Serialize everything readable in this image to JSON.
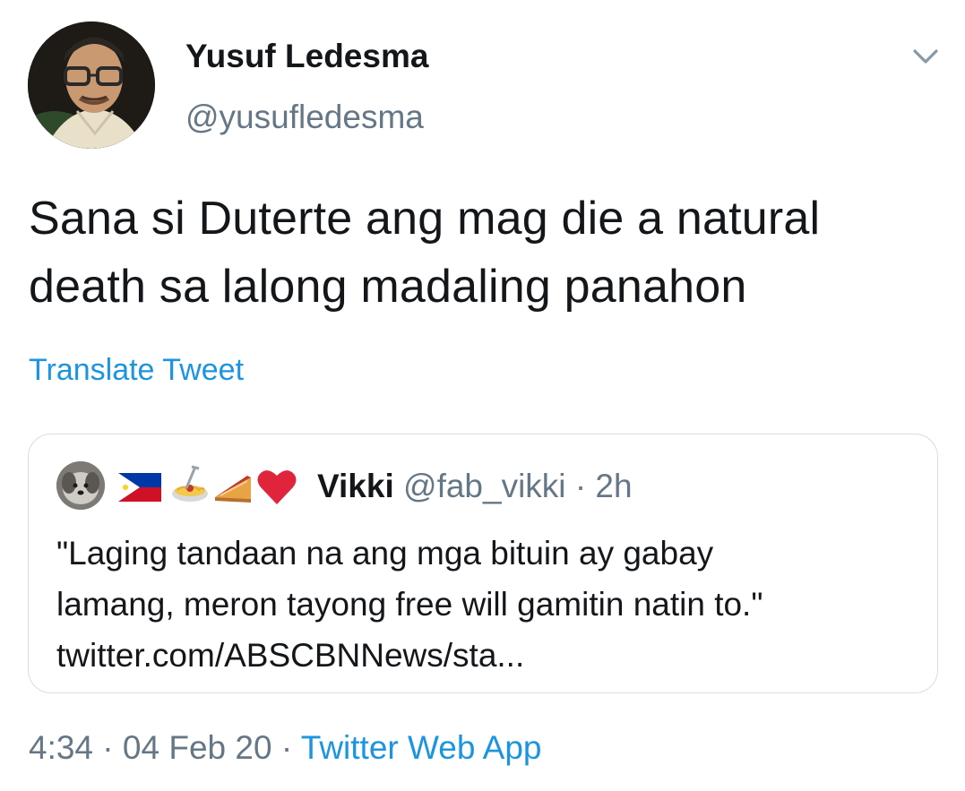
{
  "author": {
    "name": "Yusuf Ledesma",
    "handle": "@yusufledesma",
    "avatar_icon": "profile-photo"
  },
  "tweet": {
    "text": "Sana si Duterte ang mag die a natural\ndeath sa lalong madaling panahon",
    "translate_label": "Translate Tweet"
  },
  "quoted_tweet": {
    "name": "Vikki",
    "handle": "@fab_vikki",
    "separator": "·",
    "time": "2h",
    "name_emoji_icons": [
      "philippines-flag-icon",
      "spaghetti-icon",
      "pie-icon",
      "red-heart-icon"
    ],
    "text": "\"Laging tandaan na ang mga bituin ay gabay\nlamang, meron tayong free will gamitin natin to.\"\ntwitter.com/ABSCBNNews/sta..."
  },
  "footer": {
    "time": "4:34",
    "separator": "·",
    "date": "04 Feb 20",
    "source": "Twitter Web App"
  },
  "colors": {
    "link_blue": "#1b95e0",
    "secondary_text": "#657786",
    "primary_text": "#14171a",
    "card_border": "#d8dde2"
  }
}
